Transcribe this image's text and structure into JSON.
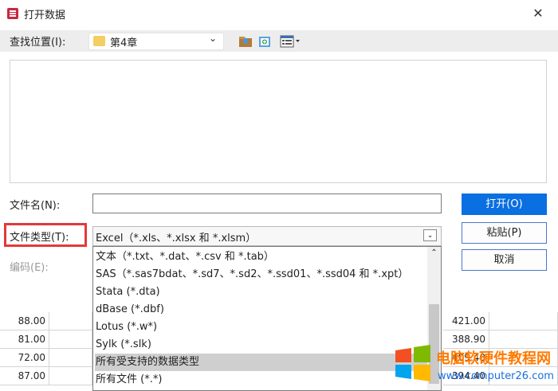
{
  "dialog": {
    "title": "打开数据",
    "close_glyph": "✕",
    "look_in": {
      "label": "查找位置(I):",
      "value": "第4章"
    },
    "file_name": {
      "label": "文件名(N):",
      "value": ""
    },
    "file_type": {
      "label": "文件类型(T):",
      "value": "Excel（*.xls、*.xlsx 和 *.xlsm）"
    },
    "encoding": {
      "label": "编码(E):"
    },
    "buttons": {
      "open": "打开(O)",
      "paste": "粘贴(P)",
      "cancel": "取消"
    },
    "file_type_options": [
      "文本（*.txt、*.dat、*.csv 和 *.tab）",
      "SAS（*.sas7bdat、*.sd7、*.sd2、*.ssd01、*.ssd04 和 *.xpt）",
      "Stata (*.dta)",
      "dBase (*.dbf)",
      "Lotus (*.w*)",
      "Sylk (*.slk)",
      "所有受支持的数据类型",
      "所有文件 (*.*)"
    ],
    "highlighted_option_index": 6,
    "colors": {
      "accent": "#0a6fe0",
      "highlight_outline": "#e23a3a"
    }
  },
  "background_sheet": {
    "left_column": [
      "88.00",
      "81.00",
      "72.00",
      "87.00"
    ],
    "right_column": [
      "421.00",
      "388.90",
      "409.40",
      "394.40"
    ]
  },
  "watermark": {
    "title": "电脑软硬件教程网",
    "url": "www.computer26.com"
  }
}
